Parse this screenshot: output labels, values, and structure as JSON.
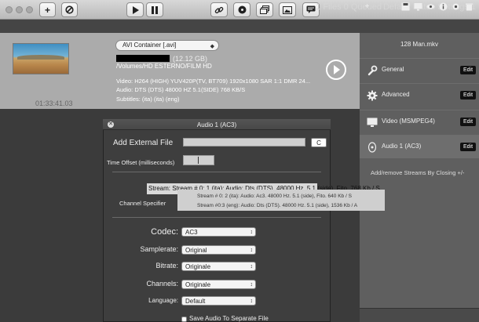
{
  "toolbar": {
    "add_label": "+",
    "icons": [
      "add-icon",
      "no-entry-icon",
      "play-icon",
      "pause-icon",
      "link-icon",
      "disc-icon",
      "stack-icon",
      "image-icon",
      "chat-icon"
    ]
  },
  "status": {
    "queue": "1 Files 0 Queued",
    "preset": "Default Batch Settings 1"
  },
  "file": {
    "container": "AVI Container [.avi]",
    "size": "(12.12 GB)",
    "path": "/Volumes/HD ESTERNO/FILM HD",
    "video": "Video: H264 (HIGH)  YUV420P(TV, BT709)  1920x1080 SAR 1:1 DMR 24...",
    "audio": "Audio: DTS (DTS) 48000 HZ  5.1(SIDE)  768 KB/S",
    "subtitles": "Subtitles: (ita) (ita) (eng)",
    "duration": "01:33:41.03"
  },
  "panel": {
    "filename": "128 Man.mkv",
    "rows": [
      {
        "label": "General",
        "edit": "Edit"
      },
      {
        "label": "Advanced",
        "edit": "Edit"
      },
      {
        "label": "Video (MSMPEG4)",
        "edit": "Edit"
      },
      {
        "label": "Audio 1 (AC3)",
        "edit": "Edit"
      }
    ],
    "streams_note": "Add/remove Streams By Closing +/-"
  },
  "dialog": {
    "title": "Audio 1 (AC3)",
    "add_external": "Add External File",
    "c_button": "C",
    "time_offset_label": "Time Offset (milliseconds)",
    "channel_specifier_label": "Channel Specifier",
    "stream_tooltip": "Stream: Stream # 0: 1 (ita): Audio: Dts (DTS). 48000 Hz. 5.1 (side). Fito. 768 Kb / S",
    "stream_options": [
      "Stream # 0: 2 (ita): Audio: Ac3. 48000 Hz. 5.1 (side), Fito. 640 Kb / S",
      "Stream #0:3 (eng): Audio: Dts (DTS). 48000 Hz. 5.1 (side), 1536 Kb / A"
    ],
    "codec_label": "Codec:",
    "codec_value": "AC3",
    "samplerate_label": "Samplerate:",
    "samplerate_value": "Original",
    "bitrate_label": "Bitrate:",
    "bitrate_value": "Originale",
    "channels_label": "Channels:",
    "channels_value": "Originale",
    "language_label": "Language:",
    "language_value": "Default",
    "save_label": "Save Audio To Separate File"
  }
}
